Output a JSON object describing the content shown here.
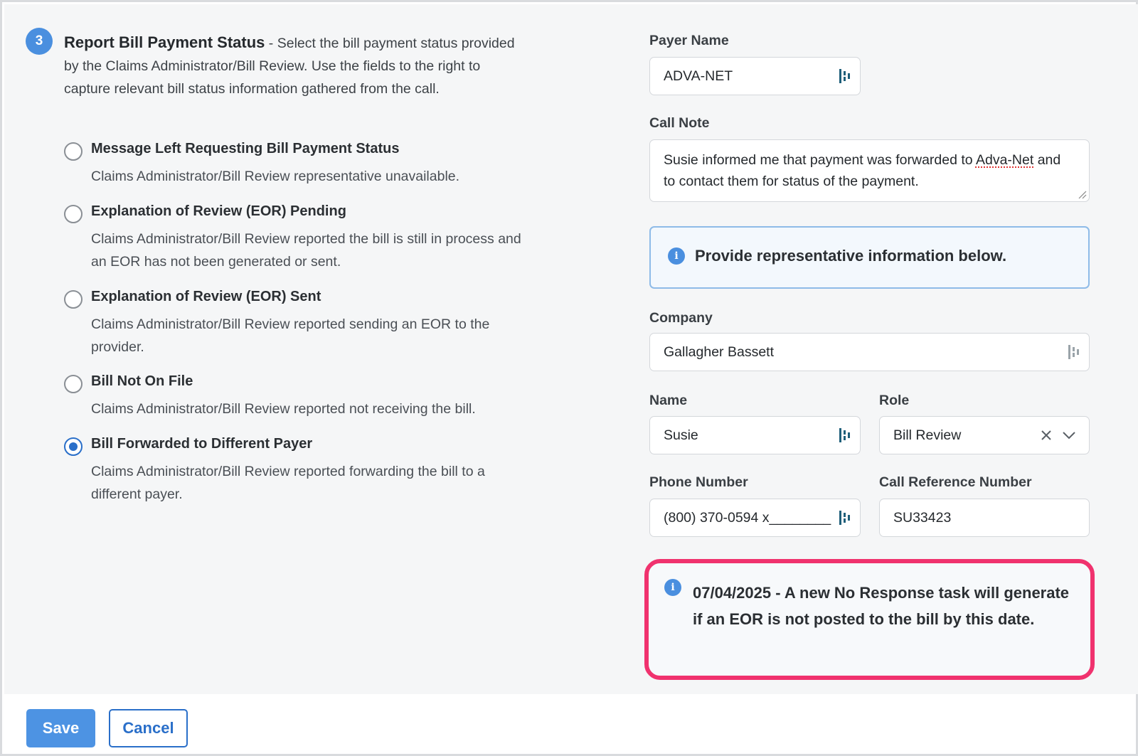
{
  "step": {
    "number": "3",
    "title": "Report Bill Payment Status",
    "description": " - Select the bill payment status provided by the Claims Administrator/Bill Review. Use the fields to the right to capture relevant bill status information gathered from the call."
  },
  "status_options": [
    {
      "label": "Message Left Requesting Bill Payment Status",
      "description": "Claims Administrator/Bill Review representative unavailable.",
      "selected": false
    },
    {
      "label": "Explanation of Review (EOR) Pending",
      "description": "Claims Administrator/Bill Review reported the bill is still in process and an EOR has not been generated or sent.",
      "selected": false
    },
    {
      "label": "Explanation of Review (EOR) Sent",
      "description": "Claims Administrator/Bill Review reported sending an EOR to the provider.",
      "selected": false
    },
    {
      "label": "Bill Not On File",
      "description": "Claims Administrator/Bill Review reported not receiving the bill.",
      "selected": false
    },
    {
      "label": "Bill Forwarded to Different Payer",
      "description": "Claims Administrator/Bill Review reported forwarding the bill to a different payer.",
      "selected": true
    }
  ],
  "payer_name": {
    "label": "Payer Name",
    "value": "ADVA-NET"
  },
  "call_note": {
    "label": "Call Note",
    "value_before": "Susie informed me that payment was forwarded to ",
    "value_flagged": "Adva-Net",
    "value_after": " and to contact them for status of the payment."
  },
  "rep_info_banner": {
    "icon": "info-icon",
    "text": "Provide representative information below."
  },
  "company": {
    "label": "Company",
    "value": "Gallagher Bassett"
  },
  "name": {
    "label": "Name",
    "value": "Susie"
  },
  "role": {
    "label": "Role",
    "value": "Bill Review"
  },
  "phone_number": {
    "label": "Phone Number",
    "value": "(800) 370-0594 x________"
  },
  "call_reference_number": {
    "label": "Call Reference Number",
    "value": "SU33423"
  },
  "no_response_alert": {
    "icon": "info-icon",
    "text": "07/04/2025 - A new No Response task will generate if an EOR is not posted to the bill by this date.",
    "highlight_color": "#f0326e"
  },
  "footer": {
    "save_label": "Save",
    "cancel_label": "Cancel"
  },
  "colors": {
    "accent": "#4a8fdf",
    "primary_button": "#4d93e3",
    "link_blue": "#2a6fc9"
  }
}
